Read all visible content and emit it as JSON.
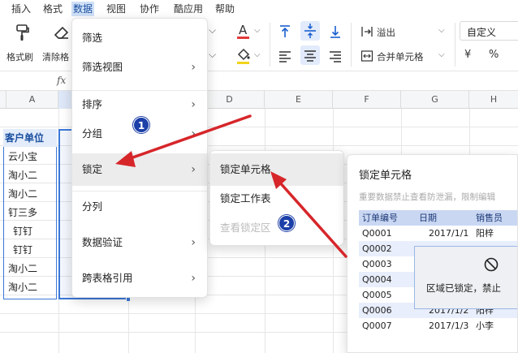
{
  "menubar": {
    "items": [
      "插入",
      "格式",
      "数据",
      "视图",
      "协作",
      "酷应用",
      "帮助"
    ]
  },
  "toolbar": {
    "format_painter": "格式刷",
    "clear_format": "清除格",
    "overflow": "溢出",
    "merge": "合并单元格",
    "number_format": "自定义",
    "currency": "¥",
    "percent": "%"
  },
  "formula_bar": {
    "fx": "fx"
  },
  "columns": [
    "A",
    "D",
    "E",
    "F",
    "G",
    "H"
  ],
  "sheet": {
    "header": "客户单位",
    "rows": [
      "云小宝",
      "淘小二",
      "淘小二",
      "钉三多",
      "钉钉",
      "钉钉",
      "淘小二",
      "淘小二"
    ]
  },
  "data_menu": {
    "items": [
      {
        "label": "筛选",
        "has_submenu": false
      },
      {
        "label": "筛选视图",
        "has_submenu": true
      },
      {
        "label": "排序",
        "has_submenu": true
      },
      {
        "label": "分组",
        "has_submenu": true
      },
      {
        "label": "锁定",
        "has_submenu": true
      },
      {
        "label": "分列",
        "has_submenu": false
      },
      {
        "label": "数据验证",
        "has_submenu": true
      },
      {
        "label": "跨表格引用",
        "has_submenu": true
      }
    ]
  },
  "lock_submenu": {
    "items": [
      {
        "label": "锁定单元格",
        "disabled": false
      },
      {
        "label": "锁定工作表",
        "disabled": false
      },
      {
        "label": "查看锁定区",
        "disabled": true
      }
    ]
  },
  "preview": {
    "title": "锁定单元格",
    "description": "重要数据禁止查看防泄漏，限制编辑",
    "headers": [
      "订单编号",
      "日期",
      "销售员"
    ],
    "rows": [
      [
        "Q0001",
        "2017/1/1",
        "阳梓"
      ],
      [
        "Q0002",
        "",
        ""
      ],
      [
        "Q0003",
        "",
        ""
      ],
      [
        "Q0004",
        "",
        ""
      ],
      [
        "Q0005",
        "",
        ""
      ],
      [
        "Q0006",
        "2017/1/2",
        "阳梓"
      ],
      [
        "Q0007",
        "2017/1/3",
        "小李"
      ]
    ],
    "lock_message": "区域已锁定，禁止"
  },
  "annotations": {
    "badge1": "1",
    "badge2": "2"
  },
  "colors": {
    "accent": "#1a5fd0",
    "arrow": "#d6262a",
    "badge": "#1c3fa8"
  }
}
